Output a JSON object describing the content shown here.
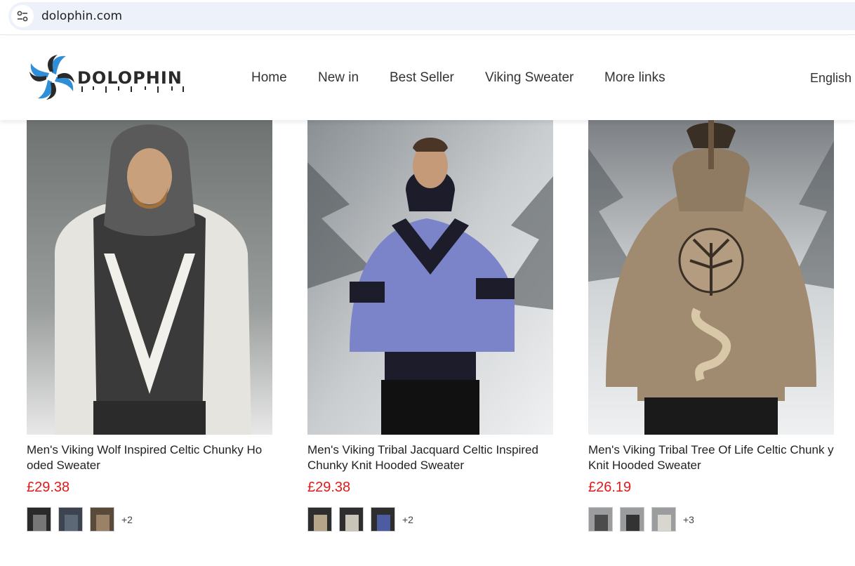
{
  "browser": {
    "url": "dolophin.com",
    "site_info_icon": "tune-icon"
  },
  "header": {
    "logo_text": "DOLOPHIN",
    "nav": [
      {
        "label": "Home"
      },
      {
        "label": "New in"
      },
      {
        "label": "Best Seller"
      },
      {
        "label": "Viking Sweater"
      },
      {
        "label": "More links"
      }
    ],
    "language": "English"
  },
  "colors": {
    "price": "#e0191b",
    "logo_blue": "#2e8fd8",
    "logo_dark": "#2a2a2a"
  },
  "products": [
    {
      "title": "Men's Viking Wolf Inspired Celtic Chunky Ho oded Sweater",
      "currency": "£",
      "price": "29.38",
      "more_variants": "+2",
      "image_colors": [
        "#5a5a5a",
        "#e6e4df",
        "#2b2b2b"
      ],
      "swatch_colors": [
        "#2a2a2a",
        "#3c4450",
        "#5a4a3a"
      ]
    },
    {
      "title": "Men's Viking Tribal Jacquard Celtic Inspired Chunky Knit Hooded Sweater",
      "currency": "£",
      "price": "29.38",
      "more_variants": "+2",
      "image_colors": [
        "#7b84c9",
        "#1c1c2a",
        "#dfe3e6"
      ],
      "swatch_colors": [
        "#b7a58a",
        "#c9c4b8",
        "#4d5ba0"
      ]
    },
    {
      "title": "Men's Viking Tribal Tree Of Life Celtic Chunk y Knit Hooded Sweater",
      "currency": "£",
      "price": "26.19",
      "more_variants": "+3",
      "image_colors": [
        "#a08a70",
        "#3a2f24",
        "#e4e6e8"
      ],
      "swatch_colors": [
        "#4b4b4b",
        "#333333",
        "#d9d6cf"
      ]
    }
  ]
}
